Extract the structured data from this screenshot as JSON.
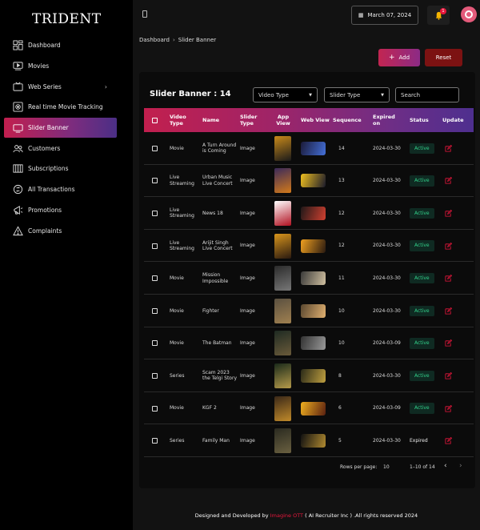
{
  "app": {
    "logo": "TRIDENT"
  },
  "sidebar": {
    "items": [
      {
        "label": "Dashboard",
        "icon": "dashboard-icon",
        "active": false
      },
      {
        "label": "Movies",
        "icon": "movies-icon",
        "active": false
      },
      {
        "label": "Web Series",
        "icon": "web-series-icon",
        "active": false,
        "chevron": "›"
      },
      {
        "label": "Real time Movie Tracking",
        "icon": "tracking-icon",
        "active": false
      },
      {
        "label": "Slider Banner",
        "icon": "slider-icon",
        "active": true
      },
      {
        "label": "Customers",
        "icon": "customers-icon",
        "active": false
      },
      {
        "label": "Subscriptions",
        "icon": "subscriptions-icon",
        "active": false
      },
      {
        "label": "All Transactions",
        "icon": "transactions-icon",
        "active": false
      },
      {
        "label": "Promotions",
        "icon": "promotions-icon",
        "active": false
      },
      {
        "label": "Complaints",
        "icon": "complaints-icon",
        "active": false
      }
    ]
  },
  "topbar": {
    "date": "March 07, 2024",
    "notification_count": "1"
  },
  "breadcrumb": {
    "root": "Dashboard",
    "separator": "›",
    "current": "Slider Banner"
  },
  "actions": {
    "add_label": "Add",
    "reset_label": "Reset"
  },
  "card": {
    "title": "Slider Banner : 14",
    "filters": {
      "video_type": "Video Type",
      "slider_type": "Slider Type",
      "search_placeholder": "Search"
    }
  },
  "table": {
    "headers": {
      "video_type": "Video Type",
      "name": "Name",
      "slider_type": "Slider Type",
      "app_view": "App View",
      "web_view": "Web View",
      "sequence": "Sequence",
      "expired_on": "Expired on",
      "status": "Status",
      "update": "Update"
    },
    "rows": [
      {
        "video_type": "Movie",
        "name": "A Turn Around is Coming",
        "slider_type": "Image",
        "sequence": "14",
        "expired_on": "2024-03-30",
        "status": "Active"
      },
      {
        "video_type": "Live Streaming",
        "name": "Urban Music Live Concert",
        "slider_type": "Image",
        "sequence": "13",
        "expired_on": "2024-03-30",
        "status": "Active"
      },
      {
        "video_type": "Live Streaming",
        "name": "News 18",
        "slider_type": "Image",
        "sequence": "12",
        "expired_on": "2024-03-30",
        "status": "Active"
      },
      {
        "video_type": "Live Streaming",
        "name": "Arijit Singh Live Concert",
        "slider_type": "Image",
        "sequence": "12",
        "expired_on": "2024-03-30",
        "status": "Active"
      },
      {
        "video_type": "Movie",
        "name": "Mission Impossible",
        "slider_type": "Image",
        "sequence": "11",
        "expired_on": "2024-03-30",
        "status": "Active"
      },
      {
        "video_type": "Movie",
        "name": "Fighter",
        "slider_type": "Image",
        "sequence": "10",
        "expired_on": "2024-03-30",
        "status": "Active"
      },
      {
        "video_type": "Movie",
        "name": "The Batman",
        "slider_type": "Image",
        "sequence": "10",
        "expired_on": "2024-03-09",
        "status": "Active"
      },
      {
        "video_type": "Series",
        "name": "Scam 2023 the Telgi Story",
        "slider_type": "Image",
        "sequence": "8",
        "expired_on": "2024-03-30",
        "status": "Active"
      },
      {
        "video_type": "Movie",
        "name": "KGF 2",
        "slider_type": "Image",
        "sequence": "6",
        "expired_on": "2024-03-09",
        "status": "Active"
      },
      {
        "video_type": "Series",
        "name": "Family Man",
        "slider_type": "Image",
        "sequence": "5",
        "expired_on": "2024-03-30",
        "status": "Expired"
      }
    ]
  },
  "pagination": {
    "rows_label": "Rows per page:",
    "rows_value": "10",
    "range": "1–10 of 14",
    "prev": "‹",
    "next": "›"
  },
  "footer": {
    "prefix": "Designed and Developed by",
    "brand": "Imagine OTT",
    "suffix": "( AI Recruiter Inc ) .All rights reserved 2024"
  },
  "colors": {
    "accent": "#c21f4e",
    "active_green": "#32d18a",
    "reset": "#7c1212"
  }
}
